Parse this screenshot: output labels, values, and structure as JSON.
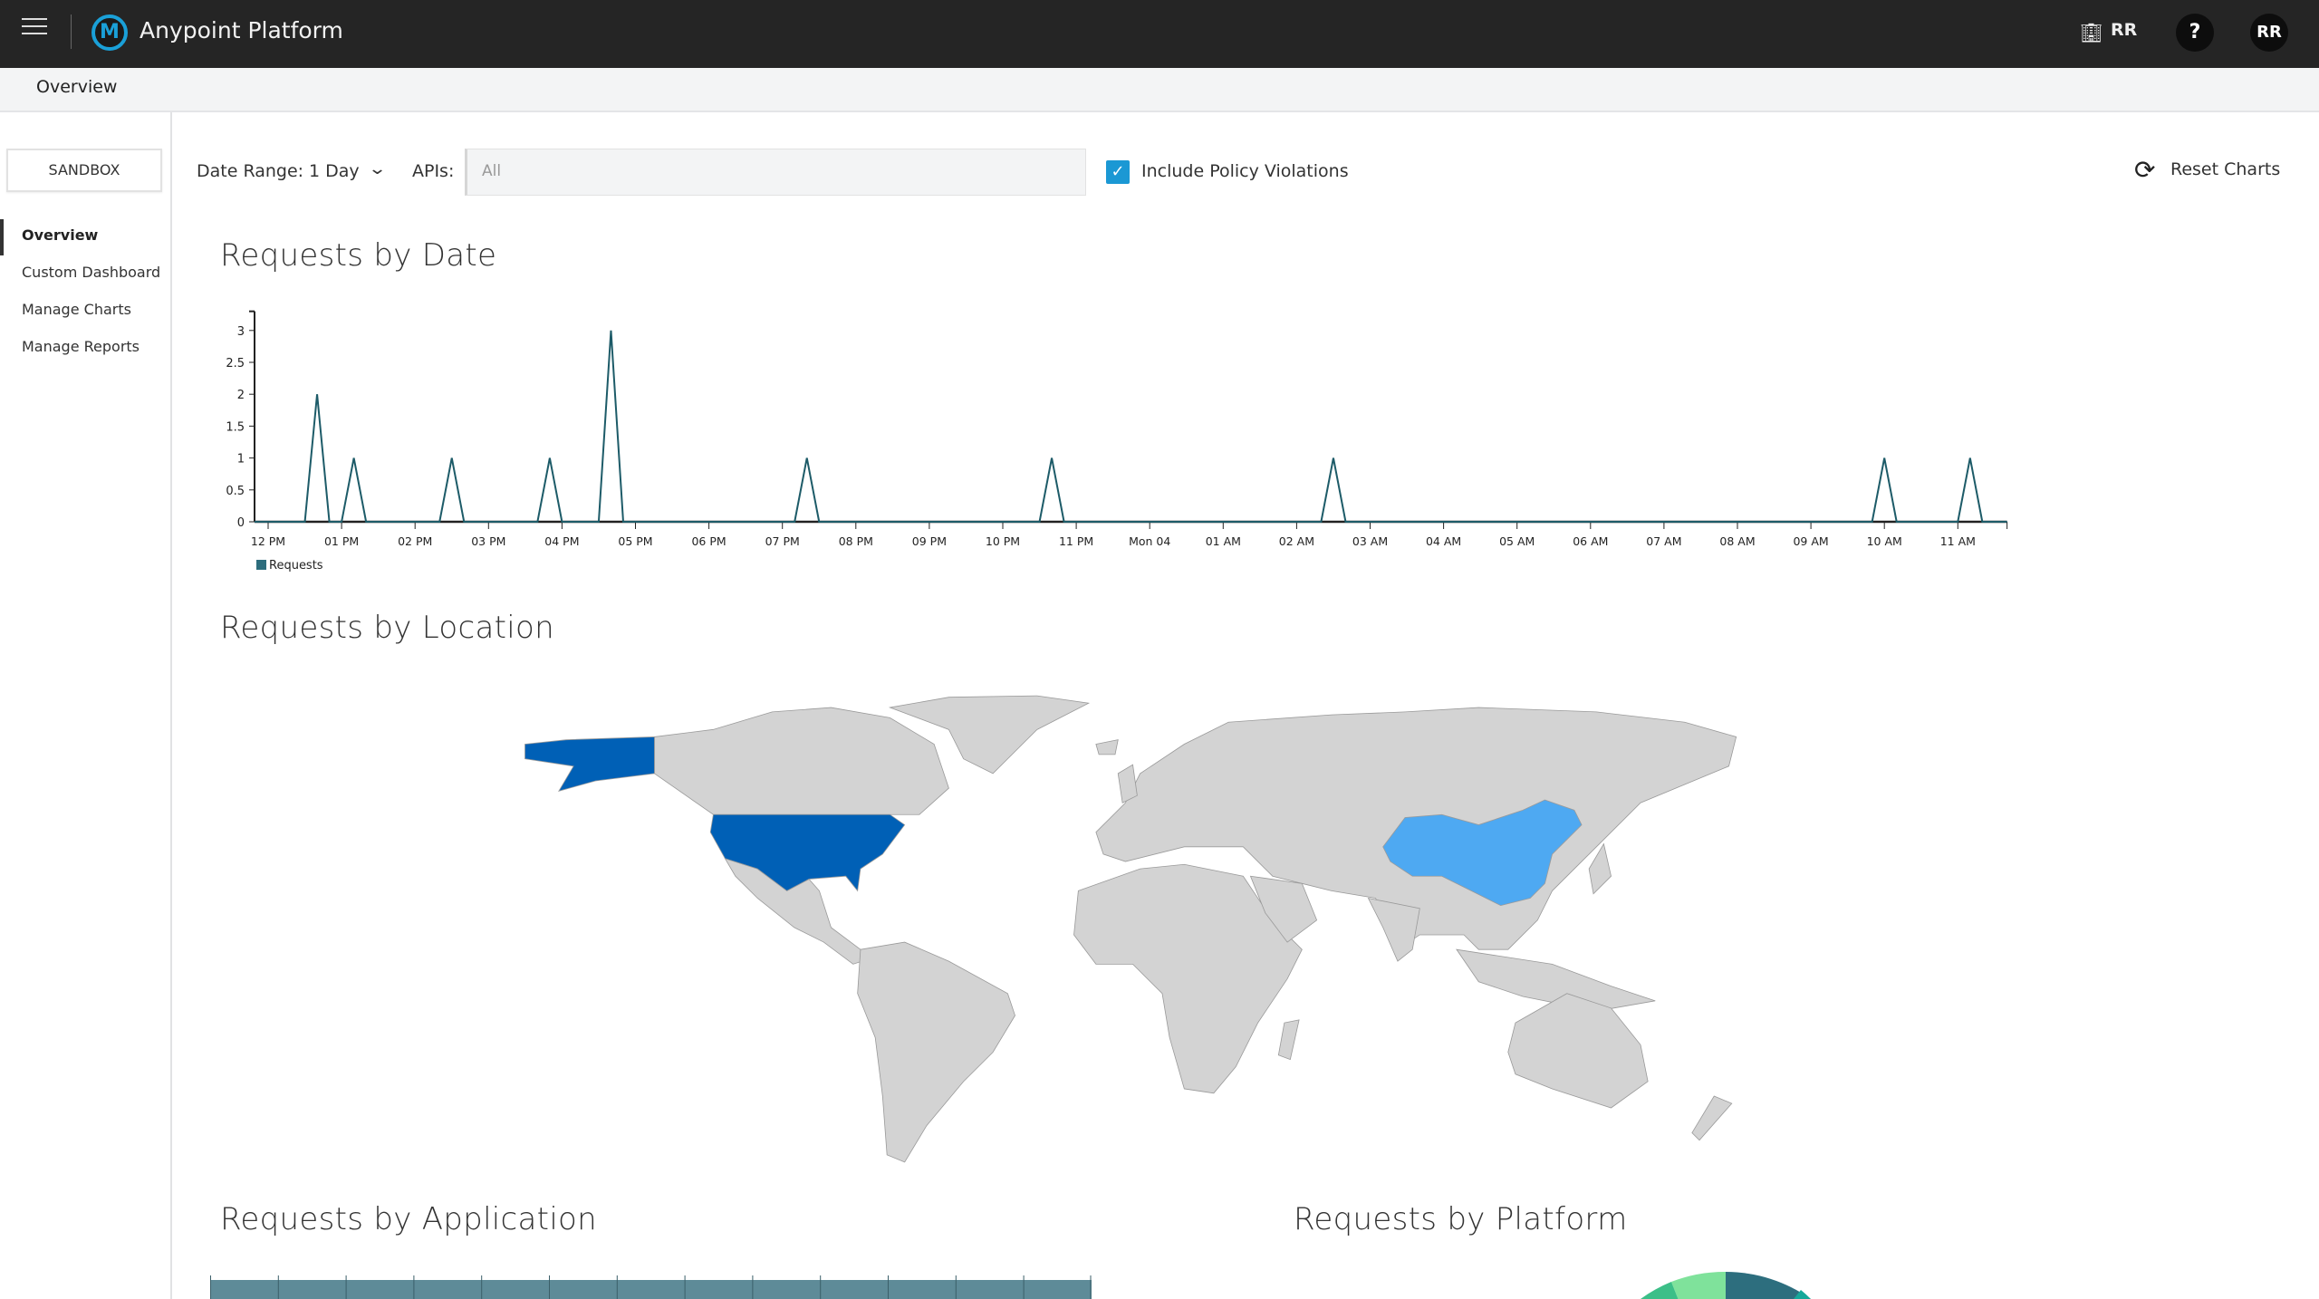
{
  "topbar": {
    "app_title": "Anypoint Platform",
    "logo_letter": "M",
    "org_name": "RR",
    "help_label": "?",
    "avatar_initials": "RR",
    "icons": {
      "menu": "hamburger-icon",
      "logo": "mulesoft-logo",
      "org": "building-icon"
    }
  },
  "subheader": {
    "title": "Overview"
  },
  "sidebar": {
    "environment": "SANDBOX",
    "items": [
      {
        "label": "Overview",
        "active": true
      },
      {
        "label": "Custom Dashboard",
        "active": false
      },
      {
        "label": "Manage Charts",
        "active": false
      },
      {
        "label": "Manage Reports",
        "active": false
      }
    ]
  },
  "toolbar": {
    "date_range_label": "Date Range:",
    "date_range_value": "1 Day",
    "apis_label": "APIs:",
    "apis_placeholder": "All",
    "policy_violations_label": "Include Policy Violations",
    "policy_violations_checked": true,
    "reset_label": "Reset Charts"
  },
  "sections": {
    "date": "Requests by Date",
    "location": "Requests by Location",
    "application": "Requests by Application",
    "platform": "Requests by Platform"
  },
  "colors": {
    "accent": "#1b98d4",
    "series": "#1d5b68",
    "legend": "#2d6d7d",
    "map_land": "#d3d3d3",
    "map_high": "#0060b6",
    "map_mid": "#4ea9f2"
  },
  "chart_data": {
    "type": "line",
    "title": "Requests by Date",
    "xlabel": "",
    "ylabel": "",
    "ylim": [
      0,
      3.3
    ],
    "yticks": [
      "0",
      "0.5",
      "1",
      "1.5",
      "2",
      "2.5",
      "3"
    ],
    "xticks": [
      "12 PM",
      "01 PM",
      "02 PM",
      "03 PM",
      "04 PM",
      "05 PM",
      "06 PM",
      "07 PM",
      "08 PM",
      "09 PM",
      "10 PM",
      "11 PM",
      "Mon 04",
      "01 AM",
      "02 AM",
      "03 AM",
      "04 AM",
      "05 AM",
      "06 AM",
      "07 AM",
      "08 AM",
      "09 AM",
      "10 AM",
      "11 AM"
    ],
    "xlim": [
      "11:50 AM",
      "11:40 AM"
    ],
    "series": [
      {
        "name": "Requests",
        "points": [
          {
            "time": "12:40 PM",
            "value": 2
          },
          {
            "time": "01:10 PM",
            "value": 1
          },
          {
            "time": "02:30 PM",
            "value": 1
          },
          {
            "time": "03:50 PM",
            "value": 1
          },
          {
            "time": "04:40 PM",
            "value": 3
          },
          {
            "time": "07:20 PM",
            "value": 1
          },
          {
            "time": "10:40 PM",
            "value": 1
          },
          {
            "time": "02:30 AM",
            "value": 1
          },
          {
            "time": "10:00 AM",
            "value": 1
          },
          {
            "time": "11:10 AM",
            "value": 1
          }
        ],
        "baseline": 0
      }
    ],
    "legend": "bottom-left",
    "grid": false
  },
  "map_data": {
    "highlighted": [
      {
        "country": "United States",
        "level": "high"
      },
      {
        "country": "China",
        "level": "mid"
      }
    ]
  }
}
